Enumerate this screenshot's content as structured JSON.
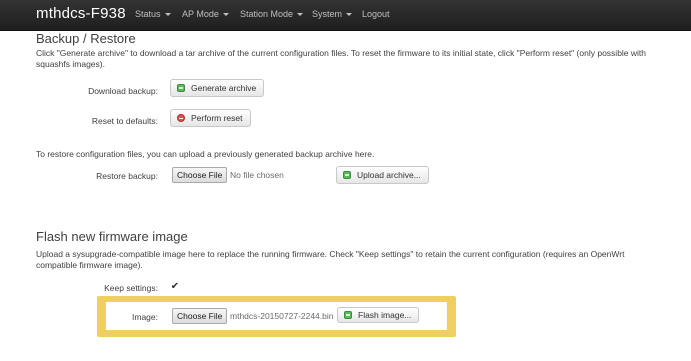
{
  "navbar": {
    "brand": "mthdcs-F938",
    "items": [
      {
        "label": "Status",
        "dropdown": true
      },
      {
        "label": "AP Mode",
        "dropdown": true
      },
      {
        "label": "Station Mode",
        "dropdown": true
      },
      {
        "label": "System",
        "dropdown": true
      },
      {
        "label": "Logout",
        "dropdown": false
      }
    ]
  },
  "backup": {
    "title": "Backup / Restore",
    "description": "Click \"Generate archive\" to download a tar archive of the current configuration files. To reset the firmware to its initial state, click \"Perform reset\" (only possible with squashfs images).",
    "download_label": "Download backup:",
    "generate_button": "Generate archive",
    "reset_label": "Reset to defaults:",
    "reset_button": "Perform reset",
    "restore_description": "To restore configuration files, you can upload a previously generated backup archive here.",
    "restore_label": "Restore backup:",
    "choose_file": "Choose File",
    "no_file": "No file chosen",
    "upload_button": "Upload archive..."
  },
  "flash": {
    "title": "Flash new firmware image",
    "description": "Upload a sysupgrade-compatible image here to replace the running firmware. Check \"Keep settings\" to retain the current configuration (requires an OpenWrt compatible firmware image).",
    "keep_label": "Keep settings:",
    "keep_checked": true,
    "keep_mark": "✔",
    "image_label": "Image:",
    "choose_file": "Choose File",
    "file_name": "mthdcs-20150727-2244.bin",
    "flash_button": "Flash image..."
  },
  "colors": {
    "navbar": "#222222",
    "highlight": "#f0cf62",
    "green_icon": "#5cb85c",
    "red_icon": "#d9534f"
  }
}
